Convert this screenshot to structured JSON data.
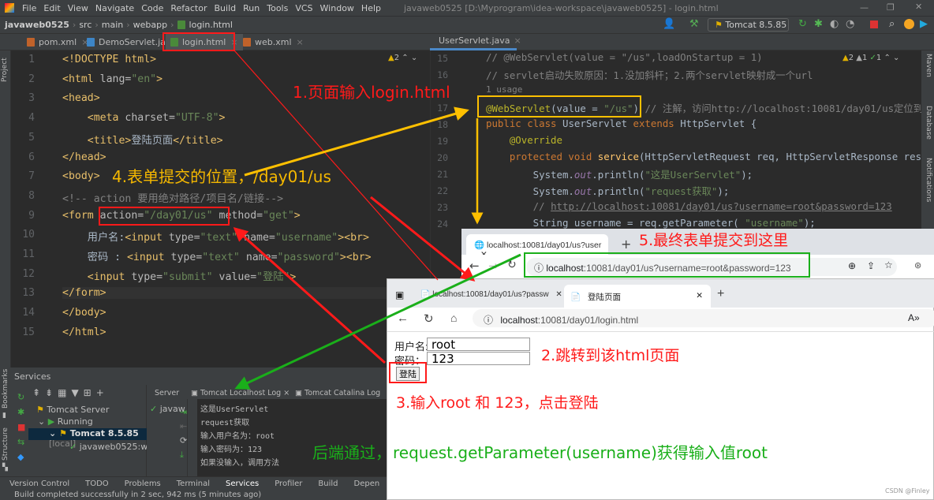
{
  "titlebar": {
    "menu": [
      "File",
      "Edit",
      "View",
      "Navigate",
      "Code",
      "Refactor",
      "Build",
      "Run",
      "Tools",
      "VCS",
      "Window",
      "Help"
    ],
    "title": "javaweb0525 [D:\\Myprogram\\idea-workspace\\javaweb0525] - login.html"
  },
  "breadcrumb": [
    "javaweb0525",
    "src",
    "main",
    "webapp",
    "login.html"
  ],
  "run_config": "Tomcat 8.5.85",
  "editor_tabs": [
    {
      "label": "pom.xml",
      "icon": "xml"
    },
    {
      "label": "DemoServlet.java",
      "icon": "java"
    },
    {
      "label": "login.html",
      "icon": "html",
      "active": true
    },
    {
      "label": "web.xml",
      "icon": "xml"
    }
  ],
  "right_tab": "UserServlet.java",
  "left_inspection": "2",
  "right_inspection": {
    "warnings": "2",
    "weak": "1",
    "ok": "1"
  },
  "left_code": {
    "start": 1,
    "lines": [
      [
        [
          "<!DOCTYPE html>",
          "t"
        ]
      ],
      [
        [
          "<html ",
          "t"
        ],
        [
          "lang=",
          "a"
        ],
        [
          "\"en\"",
          "s"
        ],
        [
          ">",
          "t"
        ]
      ],
      [
        [
          "<head>",
          "t"
        ]
      ],
      [
        [
          "    <meta ",
          "t"
        ],
        [
          "charset=",
          "a"
        ],
        [
          "\"UTF-8\"",
          "s"
        ],
        [
          ">",
          "t"
        ]
      ],
      [
        [
          "    <title>",
          "t"
        ],
        [
          "登陆页面",
          ""
        ],
        [
          "</title>",
          "t"
        ]
      ],
      [
        [
          "</head>",
          "t"
        ]
      ],
      [
        [
          "<body>",
          "t"
        ]
      ],
      [
        [
          "<!-- action 要用绝对路径/项目名/链接-->",
          "c"
        ]
      ],
      [
        [
          "<form ",
          "t"
        ],
        [
          "action=",
          "a"
        ],
        [
          "\"/day01/us\"",
          "s"
        ],
        [
          " method=",
          "a"
        ],
        [
          "\"get\"",
          "s"
        ],
        [
          ">",
          "t"
        ]
      ],
      [
        [
          "    用户名:",
          ""
        ],
        [
          "<input ",
          "t"
        ],
        [
          "type=",
          "a"
        ],
        [
          "\"text\"",
          "s"
        ],
        [
          " name=",
          "a"
        ],
        [
          "\"username\"",
          "s"
        ],
        [
          "><br>",
          "t"
        ]
      ],
      [
        [
          "    密码 : ",
          ""
        ],
        [
          "<input ",
          "t"
        ],
        [
          "type=",
          "a"
        ],
        [
          "\"text\"",
          "s"
        ],
        [
          " name=",
          "a"
        ],
        [
          "\"password\"",
          "s"
        ],
        [
          "><br>",
          "t"
        ]
      ],
      [
        [
          "    <input ",
          "t"
        ],
        [
          "type=",
          "a"
        ],
        [
          "\"submit\"",
          "s"
        ],
        [
          " value=",
          "a"
        ],
        [
          "\"登陆\"",
          "s"
        ],
        [
          ">",
          "t"
        ]
      ],
      [
        [
          "</form>",
          "t"
        ]
      ],
      [
        [
          "</body>",
          "t"
        ]
      ],
      [
        [
          "</html>",
          "t"
        ]
      ]
    ]
  },
  "right_code": {
    "lines": [
      {
        "n": "15",
        "seg": [
          [
            "// @WebServlet(value = \"/us\",loadOnStartup = 1)",
            "c"
          ]
        ]
      },
      {
        "n": "16",
        "seg": [
          [
            "// servlet启动失败原因：1.没加斜杆；2.两个servlet映射成一个url",
            "c"
          ]
        ]
      },
      {
        "n": "",
        "seg": [
          [
            "1 usage",
            "c"
          ]
        ]
      },
      {
        "n": "17",
        "seg": [
          [
            "@WebServlet",
            "an"
          ],
          [
            "(value = ",
            ""
          ],
          [
            "\"/us\"",
            "s"
          ],
          [
            ")",
            ""
          ],
          [
            " // 注解，访问http://localhost:10081/day01/us定位到",
            "c"
          ]
        ]
      },
      {
        "n": "18",
        "seg": [
          [
            "public class ",
            "k"
          ],
          [
            "UserServlet ",
            ""
          ],
          [
            "extends ",
            "k"
          ],
          [
            "HttpServlet {",
            ""
          ]
        ]
      },
      {
        "n": "19",
        "seg": [
          [
            "    @Override",
            "an"
          ]
        ]
      },
      {
        "n": "20",
        "seg": [
          [
            "    protected void ",
            "k"
          ],
          [
            "service",
            "f"
          ],
          [
            "(HttpServletRequest req, HttpServletResponse resp",
            ""
          ]
        ]
      },
      {
        "n": "21",
        "seg": [
          [
            "        System.",
            ""
          ],
          [
            "out",
            "i"
          ],
          [
            ".println(",
            ""
          ],
          [
            "\"这是UserServlet\"",
            "s"
          ],
          [
            ");",
            ""
          ]
        ]
      },
      {
        "n": "22",
        "seg": [
          [
            "        System.",
            ""
          ],
          [
            "out",
            "i"
          ],
          [
            ".println(",
            ""
          ],
          [
            "\"request获取\"",
            "s"
          ],
          [
            ");",
            ""
          ]
        ]
      },
      {
        "n": "23",
        "seg": [
          [
            "        // ",
            "c"
          ],
          [
            "http://localhost:10081/day01/us?username=root&password=123",
            "u"
          ]
        ]
      },
      {
        "n": "24",
        "seg": [
          [
            "        String username = req.getParameter( ",
            ""
          ],
          [
            "\"username\"",
            "s"
          ],
          [
            ");",
            ""
          ]
        ]
      }
    ]
  },
  "right_strip": [
    "Maven",
    "Database",
    "Notifications"
  ],
  "left_strip": [
    "Project",
    "Bookmarks",
    "Structure"
  ],
  "services": {
    "title": "Services",
    "tree": [
      "Tomcat Server",
      "Running",
      "Tomcat 8.5.85",
      "[local]",
      "javaweb0525:wa"
    ],
    "tabs": [
      "Server",
      "Tomcat Localhost Log",
      "Tomcat Catalina Log"
    ],
    "deploy": "javaw",
    "log": [
      "这是UserServlet",
      "request获取",
      "输入用户名为：root",
      "输入密码为：123",
      "如果没输入，调用方法"
    ]
  },
  "bottom_tabs": [
    "Version Control",
    "TODO",
    "Problems",
    "Terminal",
    "Services",
    "Profiler",
    "Build",
    "Depen"
  ],
  "status": "Build completed successfully in 2 sec, 942 ms (5 minutes ago)",
  "browser1": {
    "tab": "localhost:10081/day01/us?user",
    "url_host": "localhost",
    "url_rest": ":10081/day01/us?username=root&password=123"
  },
  "browser2": {
    "tab1": "localhost:10081/day01/us?passw",
    "tab2": "登陆页面",
    "url_host": "localhost",
    "url_rest": ":10081/day01/login.html",
    "form": {
      "user_label": "用户名:",
      "user_value": "root",
      "pass_label": "密码：",
      "pass_value": "123",
      "submit": "登陆"
    }
  },
  "annotations": {
    "a1": "1.页面输入login.html",
    "a2": "2.跳转到该html页面",
    "a3": "3.输入root 和 123，点击登陆",
    "a4": "4.表单提交的位置，/day01/us",
    "a5": "5.最终表单提交到这里",
    "a6": "后端通过，",
    "a7": "request.getParameter(username)获得输入值root"
  },
  "colors": {
    "red": "#ff1a1a",
    "orange": "#ffc000",
    "green": "#1aaf1a",
    "annotation_yellow": "#f5b800"
  },
  "watermark": "CSDN @Finley"
}
